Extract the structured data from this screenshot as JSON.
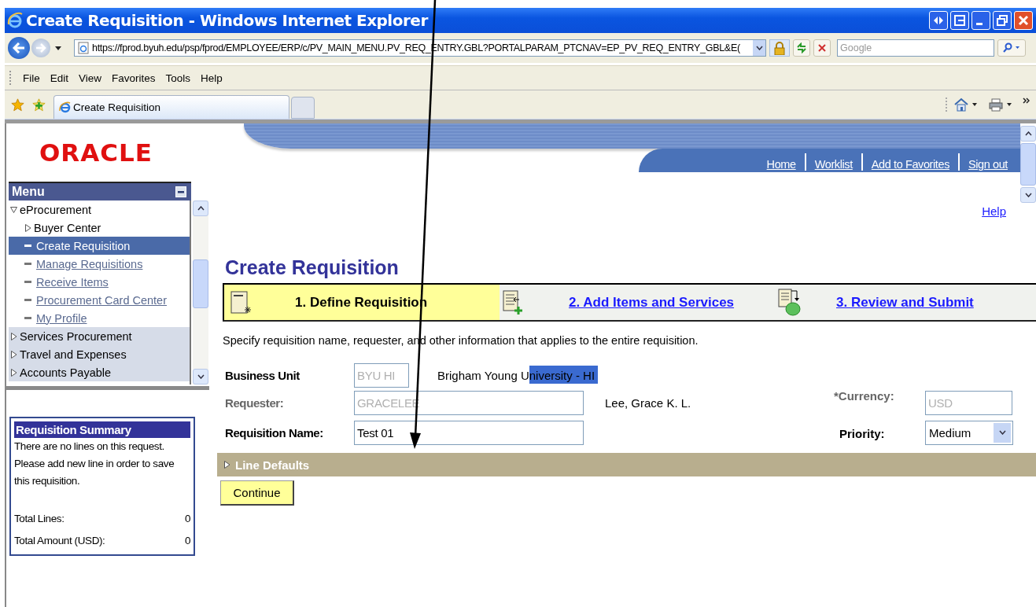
{
  "window": {
    "title": "Create Requisition - Windows Internet Explorer"
  },
  "address_bar": {
    "value": "https://fprod.byuh.edu/psp/fprod/EMPLOYEE/ERP/c/PV_MAIN_MENU.PV_REQ_ENTRY.GBL?PORTALPARAM_PTCNAV=EP_PV_REQ_ENTRY_GBL&E(",
    "search_placeholder": "Google"
  },
  "menu_bar": [
    "File",
    "Edit",
    "View",
    "Favorites",
    "Tools",
    "Help"
  ],
  "tabs": [
    {
      "label": "Create Requisition",
      "selected": true
    }
  ],
  "logo": "ORACLE",
  "header_links": [
    "Home",
    "Worklist",
    "Add to Favorites",
    "Sign out"
  ],
  "menu": {
    "title": "Menu",
    "items": [
      {
        "label": "eProcurement",
        "kind": "folder",
        "expanded": true,
        "children": [
          {
            "label": "Buyer Center",
            "kind": "folder",
            "expanded": false,
            "selected": false
          },
          {
            "label": "Create Requisition",
            "kind": "page",
            "selected": true
          },
          {
            "label": "Manage Requisitions",
            "kind": "page",
            "selected": false
          },
          {
            "label": "Receive Items",
            "kind": "page",
            "selected": false
          },
          {
            "label": "Procurement Card Center",
            "kind": "page",
            "selected": false
          },
          {
            "label": "My Profile",
            "kind": "page",
            "selected": false
          }
        ]
      },
      {
        "label": "Services Procurement",
        "kind": "folder",
        "expanded": false
      },
      {
        "label": "Travel and Expenses",
        "kind": "folder",
        "expanded": false
      },
      {
        "label": "Accounts Payable",
        "kind": "folder",
        "expanded": false
      }
    ]
  },
  "summary": {
    "title": "Requisition Summary",
    "message": "There are no lines on this request. Please add new line in order to save this requisition.",
    "totals": [
      {
        "label": "Total Lines:",
        "value": "0"
      },
      {
        "label": "Total Amount (USD):",
        "value": "0"
      }
    ]
  },
  "help_link": "Help",
  "page_title": "Create Requisition",
  "steps": [
    {
      "label": "1. Define Requisition",
      "selected": true
    },
    {
      "label": "2. Add Items and Services",
      "selected": false
    },
    {
      "label": "3. Review and Submit",
      "selected": false
    }
  ],
  "instructions": "Specify requisition name, requester, and other information that applies to the entire requisition.",
  "form": {
    "business_unit": {
      "label": "Business Unit",
      "value": "BYU HI",
      "description": [
        {
          "text": "Brigham Young U",
          "selected": false
        },
        {
          "text": "niversity - HI",
          "selected": true
        }
      ]
    },
    "requester": {
      "label": "Requester:",
      "value": "GRACELEE",
      "disabled": true,
      "name": "Lee, Grace K. L."
    },
    "currency": {
      "label": "*Currency:",
      "value": "USD",
      "disabled": true
    },
    "requisition_name": {
      "label": "Requisition Name:",
      "value": "Test 01"
    },
    "priority": {
      "label": "Priority:",
      "value": "Medium"
    }
  },
  "line_defaults": {
    "label": "Line Defaults",
    "expanded": false
  },
  "continue_button": "Continue"
}
